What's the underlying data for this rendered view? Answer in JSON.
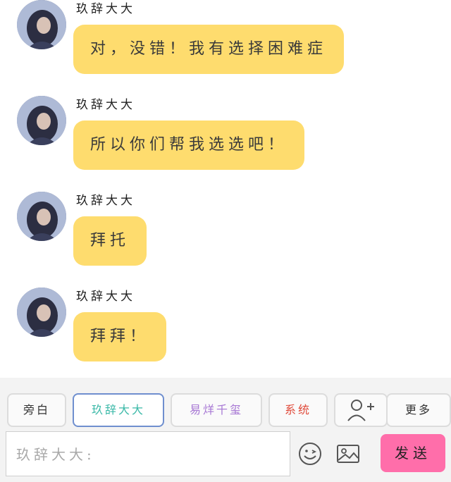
{
  "messages": [
    {
      "sender": "玖辞大大",
      "text": "对，没错！我有选择困难症"
    },
    {
      "sender": "玖辞大大",
      "text": "所以你们帮我选选吧！"
    },
    {
      "sender": "玖辞大大",
      "text": "拜托"
    },
    {
      "sender": "玖辞大大",
      "text": "拜拜！"
    }
  ],
  "roles": {
    "narrator": "旁白",
    "jiuci": "玖辞大大",
    "yiyang": "易烊千玺",
    "system": "系统",
    "more": "更多"
  },
  "composer": {
    "placeholder": "玖辞大大:",
    "send_label": "发送"
  },
  "colors": {
    "bubble": "#fedc6e",
    "send": "#ff6eaa",
    "role_jiuci": "#3bb9a8",
    "role_yiyang": "#a777d4",
    "role_system": "#e04a3a",
    "active_border": "#6f8fcf"
  },
  "icons": [
    "avatar",
    "add-person-icon",
    "emoji-icon",
    "image-icon"
  ]
}
